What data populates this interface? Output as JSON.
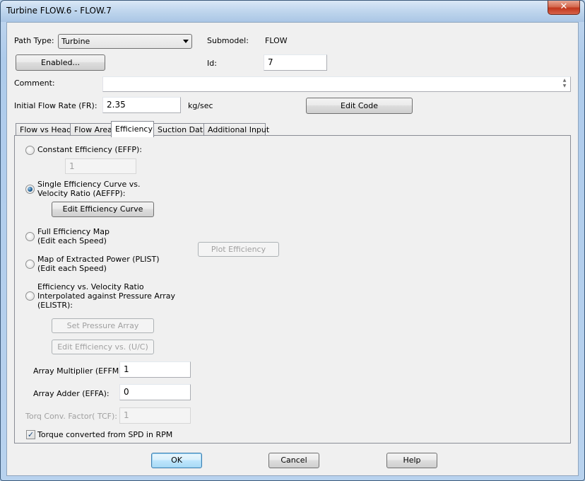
{
  "window": {
    "title": "Turbine FLOW.6 - FLOW.7",
    "close_glyph": "✕"
  },
  "header": {
    "path_type_label": "Path Type:",
    "path_type_value": "Turbine",
    "submodel_label": "Submodel:",
    "submodel_value": "FLOW",
    "enabled_button": "Enabled...",
    "id_label": "Id:",
    "id_value": "7",
    "comment_label": "Comment:",
    "comment_value": "",
    "flow_rate_label": "Initial Flow Rate (FR):",
    "flow_rate_value": "2.35",
    "flow_rate_unit": "kg/sec",
    "edit_code_button": "Edit Code"
  },
  "tabs": [
    {
      "label": "Flow vs Head",
      "active": false
    },
    {
      "label": "Flow Area",
      "active": false
    },
    {
      "label": "Efficiency",
      "active": true
    },
    {
      "label": "Suction Data",
      "active": false
    },
    {
      "label": "Additional Input",
      "active": false
    }
  ],
  "efficiency": {
    "options": [
      {
        "label_lines": [
          "Constant Efficiency (EFFP):"
        ],
        "checked": false
      },
      {
        "label_lines": [
          "Single Efficiency Curve vs.",
          "Velocity Ratio (AEFFP):"
        ],
        "checked": true
      },
      {
        "label_lines": [
          "Full Efficiency Map",
          "(Edit each Speed)"
        ],
        "checked": false
      },
      {
        "label_lines": [
          "Map of Extracted Power (PLIST)",
          "(Edit each Speed)"
        ],
        "checked": false
      },
      {
        "label_lines": [
          "Efficiency vs. Velocity Ratio",
          "Interpolated against Pressure Array",
          "(ELISTR):"
        ],
        "checked": false
      }
    ],
    "constant_efficiency_value": "1",
    "edit_efficiency_curve_button": "Edit Efficiency Curve",
    "plot_efficiency_button": "Plot Efficiency",
    "set_pressure_array_button": "Set Pressure Array",
    "edit_efficiency_uc_button": "Edit Efficiency vs. (U/C)",
    "array_multiplier_label": "Array Multiplier (EFFM):",
    "array_multiplier_value": "1",
    "array_adder_label": "Array Adder (EFFA):",
    "array_adder_value": "0",
    "torque_factor_label": "Torq Conv. Factor( TCF):",
    "torque_factor_value": "1",
    "torque_rpm_label": "Torque converted from SPD in RPM",
    "torque_rpm_checked": true
  },
  "footer": {
    "ok_button": "OK",
    "cancel_button": "Cancel",
    "help_button": "Help"
  }
}
